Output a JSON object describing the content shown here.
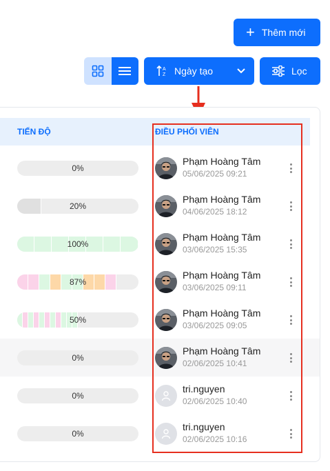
{
  "toolbar": {
    "add_label": "Thêm mới",
    "sort_label": "Ngày tạo",
    "filter_label": "Lọc"
  },
  "table": {
    "columns": {
      "progress": "TIẾN ĐỘ",
      "coordinator": "ĐIỀU PHỐI VIÊN"
    },
    "rows": [
      {
        "progress_label": "0%",
        "progress": 0,
        "name": "Phạm Hoàng Tâm",
        "date": "05/06/2025 09:21",
        "avatar": "photo"
      },
      {
        "progress_label": "20%",
        "progress": 20,
        "name": "Phạm Hoàng Tâm",
        "date": "04/06/2025 18:12",
        "avatar": "photo"
      },
      {
        "progress_label": "100%",
        "progress": 100,
        "name": "Phạm Hoàng Tâm",
        "date": "03/06/2025 15:35",
        "avatar": "photo"
      },
      {
        "progress_label": "87%",
        "progress": 87,
        "name": "Phạm Hoàng Tâm",
        "date": "03/06/2025 09:11",
        "avatar": "photo"
      },
      {
        "progress_label": "50%",
        "progress": 50,
        "name": "Phạm Hoàng Tâm",
        "date": "03/06/2025 09:05",
        "avatar": "photo"
      },
      {
        "progress_label": "0%",
        "progress": 0,
        "name": "Phạm Hoàng Tâm",
        "date": "02/06/2025 10:41",
        "avatar": "photo",
        "highlighted": true
      },
      {
        "progress_label": "0%",
        "progress": 0,
        "name": "tri.nguyen",
        "date": "02/06/2025 10:40",
        "avatar": "default"
      },
      {
        "progress_label": "0%",
        "progress": 0,
        "name": "tri.nguyen",
        "date": "02/06/2025 10:16",
        "avatar": "default"
      }
    ]
  },
  "colors": {
    "primary": "#0d6efd",
    "header_bg": "#e7f1fd",
    "annotation": "#e62e1e",
    "seg_green": "#dcf7e2",
    "seg_pink": "#fbd3e9",
    "seg_orange": "#fdd8a8"
  }
}
